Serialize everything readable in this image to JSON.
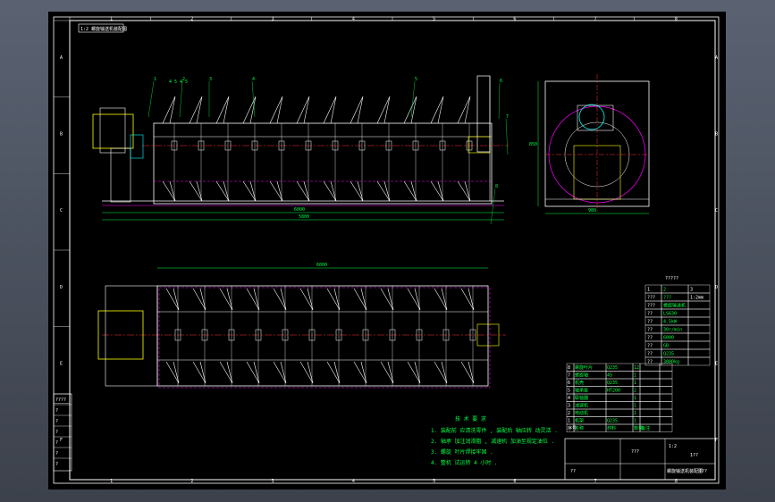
{
  "title_block_tag": "1:2  螺旋输送机装配图",
  "front_view": {
    "dim_top": "4 5 4 5",
    "dim_total": "6000",
    "dim_sub": "5800",
    "leader_labels": [
      "1",
      "2",
      "3",
      "4",
      "5",
      "6",
      "7",
      "8"
    ]
  },
  "side_view": {
    "dim_height": "850",
    "dim_width": "980"
  },
  "top_view": {
    "dim_total": "6000"
  },
  "tech_requirements": {
    "heading": "技 术 要 求",
    "lines": [
      "1. 装配前 应清洗零件 , 装配后 轴应转 动灵活 .",
      "2. 轴承 加注润滑脂 , 减速机 加油至规定油位 .",
      "3. 螺旋 叶片焊接牢固 .",
      "4. 整机 试运转 4 小时 ."
    ]
  },
  "spec_table": {
    "caption": "?????",
    "rows": [
      [
        "1",
        "2",
        "3"
      ],
      [
        "???",
        "???",
        "1:2mm"
      ],
      [
        "???",
        "螺旋输送机",
        ""
      ],
      [
        "??",
        "LS630",
        ""
      ],
      [
        "??",
        "4.5kW",
        ""
      ],
      [
        "??",
        "30r/min",
        ""
      ],
      [
        "??",
        "6000",
        ""
      ],
      [
        "??",
        "GB",
        ""
      ],
      [
        "??",
        "Q235",
        ""
      ],
      [
        "??",
        "3000kg",
        ""
      ]
    ]
  },
  "bom": {
    "rows": [
      [
        "8",
        "螺旋叶片",
        "Q235",
        "12",
        "",
        ""
      ],
      [
        "7",
        "螺旋轴",
        "45",
        "1",
        "",
        ""
      ],
      [
        "6",
        "机壳",
        "Q235",
        "1",
        "",
        ""
      ],
      [
        "5",
        "轴承座",
        "HT200",
        "2",
        "",
        ""
      ],
      [
        "4",
        "联轴器",
        "",
        "1",
        "",
        ""
      ],
      [
        "3",
        "减速机",
        "",
        "1",
        "",
        ""
      ],
      [
        "2",
        "电动机",
        "",
        "1",
        "",
        ""
      ],
      [
        "1",
        "机架",
        "Q235",
        "1",
        "",
        ""
      ]
    ],
    "header": [
      "序号",
      "名称",
      "材料",
      "数量",
      "备注",
      ""
    ]
  },
  "title_block": {
    "drawing_name": "螺旋输送机装配图",
    "scale": "1:2",
    "sheet": "???",
    "designer": "??",
    "field_a": "???",
    "field_b": "1??"
  },
  "revision_block": {
    "labels": [
      "????",
      "?",
      "?",
      "?",
      "?",
      "?",
      "?"
    ]
  },
  "frame_ticks": {
    "top": [
      "1",
      "2",
      "3",
      "4",
      "5",
      "6",
      "7",
      "8"
    ],
    "left": [
      "A",
      "B",
      "C",
      "D",
      "E",
      "F"
    ]
  },
  "colors": {
    "background": "#000000",
    "frame": "#ffffff",
    "outline": "#ffffff",
    "hidden_line": "#ff00ff",
    "center_line": "#ff3030",
    "dimension": "#00ff44",
    "hatch": "#00ffff",
    "motor": "#ffff00"
  }
}
